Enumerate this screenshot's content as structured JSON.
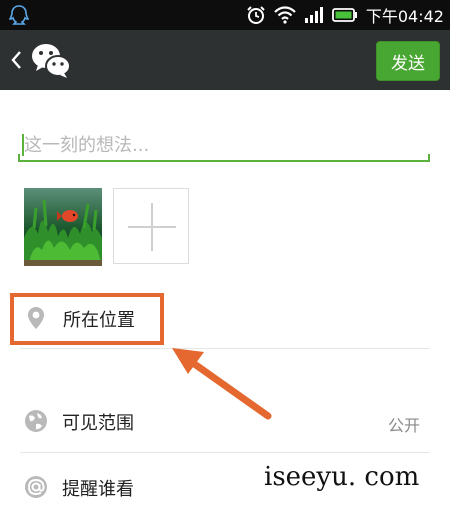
{
  "status_bar": {
    "time": "下午04:42",
    "icons": [
      "qq-icon",
      "alarm-icon",
      "wifi-icon",
      "signal-icon",
      "battery-icon"
    ],
    "battery_color": "#47c23a"
  },
  "title_bar": {
    "back_icon": "chevron-left-icon",
    "logo_icon": "wechat-logo-icon",
    "send_label": "发送",
    "send_color": "#48a632"
  },
  "composer": {
    "placeholder": "这一刻的想法...",
    "accent_color": "#5bb33d",
    "photos": [
      {
        "name": "aquarium-photo"
      }
    ],
    "add_photo_icon": "plus-icon"
  },
  "rows": {
    "location": {
      "label": "所在位置",
      "icon": "location-pin-icon"
    },
    "visibility": {
      "label": "可见范围",
      "value": "公开",
      "icon": "globe-icon"
    },
    "remind": {
      "label": "提醒谁看",
      "icon": "at-icon"
    }
  },
  "annotation": {
    "color": "#e4682f"
  },
  "watermark": "iseeyu. com"
}
